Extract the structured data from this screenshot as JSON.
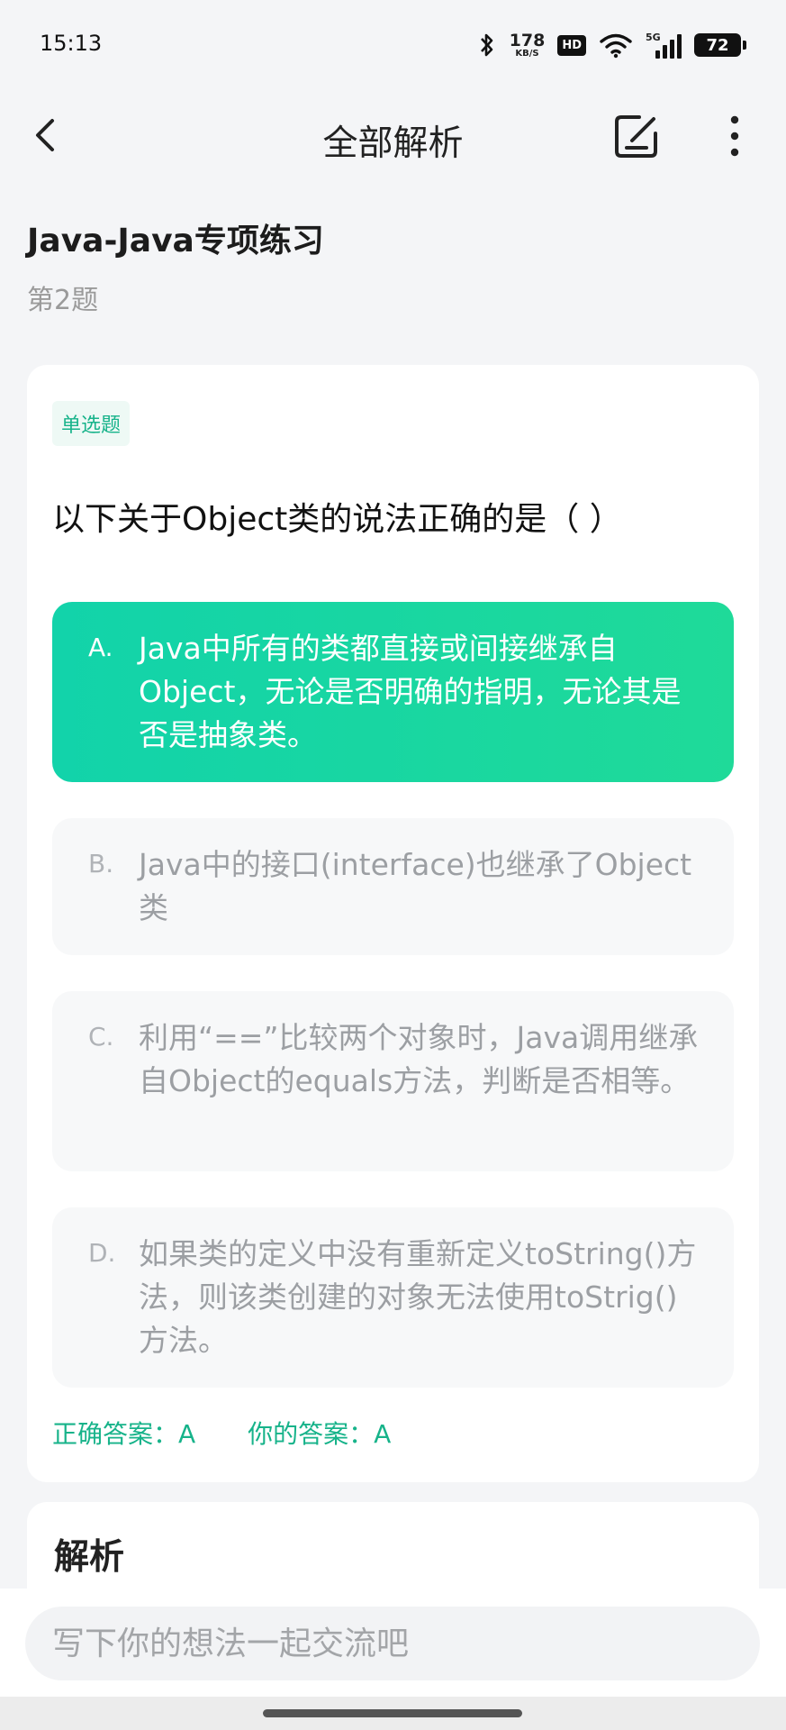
{
  "status_bar": {
    "time": "15:13",
    "speed_value": "178",
    "speed_unit": "KB/S",
    "hd": "HD",
    "network": "5G",
    "battery": "72"
  },
  "nav": {
    "title": "全部解析"
  },
  "header": {
    "title": "Java-Java专项练习",
    "question_index": "第2题"
  },
  "question": {
    "type_tag": "单选题",
    "text": "以下关于Object类的说法正确的是（ ）",
    "options": [
      {
        "letter": "A.",
        "text": "Java中所有的类都直接或间接继承自Object，无论是否明确的指明，无论其是否是抽象类。",
        "selected": true
      },
      {
        "letter": "B.",
        "text": "Java中的接口(interface)也继承了Object类",
        "selected": false
      },
      {
        "letter": "C.",
        "text": "利用“==”比较两个对象时，Java调用继承自Object的equals方法，判断是否相等。",
        "selected": false
      },
      {
        "letter": "D.",
        "text": "如果类的定义中没有重新定义toString()方法，则该类创建的对象无法使用toStrig()方法。",
        "selected": false
      }
    ],
    "correct_answer_label": "正确答案：A",
    "your_answer_label": "你的答案：A"
  },
  "analysis": {
    "title": "解析"
  },
  "comment": {
    "placeholder": "写下你的想法一起交流吧"
  },
  "colors": {
    "accent": "#17b38a",
    "selected_gradient_start": "#12d3aa",
    "selected_gradient_end": "#1fda99",
    "background": "#f4f5f7"
  }
}
